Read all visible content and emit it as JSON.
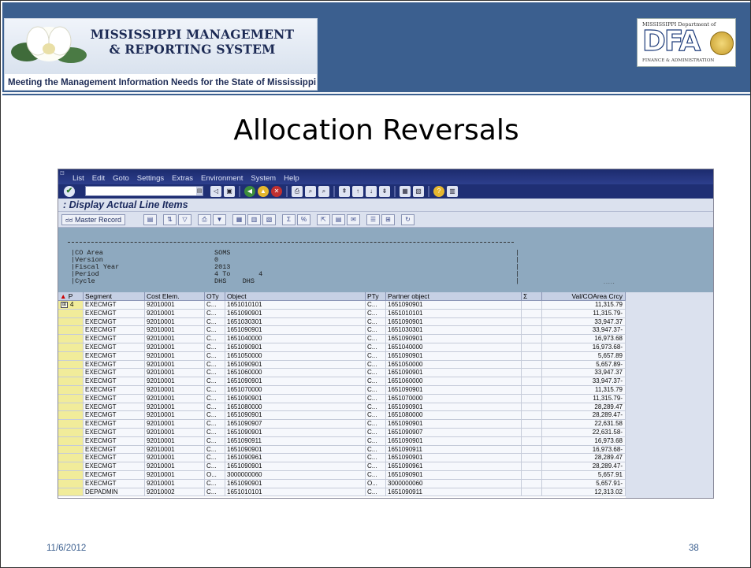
{
  "header": {
    "mmrs_title_line1": "MISSISSIPPI MANAGEMENT",
    "mmrs_title_line2": "& REPORTING SYSTEM",
    "mmrs_subtitle": "Meeting the Management Information Needs for the State of Mississippi",
    "dfa_top": "MISSISSIPPI Department of",
    "dfa_letters": "DFA",
    "dfa_bottom": "FINANCE & ADMINISTRATION",
    "band_color": "#3b5f8f"
  },
  "slide_title": "Allocation Reversals",
  "sap": {
    "menu": [
      "List",
      "Edit",
      "Goto",
      "Settings",
      "Extras",
      "Environment",
      "System",
      "Help"
    ],
    "title": ": Display Actual Line Items",
    "master_record_label": "Master Record",
    "info": {
      "rows": [
        {
          "label": "CO Area",
          "value": "SOMS"
        },
        {
          "label": "Version",
          "value": "0"
        },
        {
          "label": "Fiscal Year",
          "value": "2013"
        },
        {
          "label": "Period",
          "value": "4 To       4"
        },
        {
          "label": "Cycle",
          "value": "DHS    DHS"
        }
      ]
    },
    "columns": [
      "P",
      "Segment",
      "Cost Elem.",
      "OTy",
      "Object",
      "PTy",
      "Partner object",
      "Σ",
      "Val/COArea Crcy"
    ],
    "first_row_marker": "4",
    "rows": [
      {
        "seg": "EXECMGT",
        "ce": "92010001",
        "oty": "C...",
        "obj": "1651010101",
        "pty": "C...",
        "pobj": "1651090901",
        "val": "11,315.79"
      },
      {
        "seg": "EXECMGT",
        "ce": "92010001",
        "oty": "C...",
        "obj": "1651090901",
        "pty": "C...",
        "pobj": "1651010101",
        "val": "11,315.79-"
      },
      {
        "seg": "EXECMGT",
        "ce": "92010001",
        "oty": "C...",
        "obj": "1651030301",
        "pty": "C...",
        "pobj": "1651090901",
        "val": "33,947.37"
      },
      {
        "seg": "EXECMGT",
        "ce": "92010001",
        "oty": "C...",
        "obj": "1651090901",
        "pty": "C...",
        "pobj": "1651030301",
        "val": "33,947.37-"
      },
      {
        "seg": "EXECMGT",
        "ce": "92010001",
        "oty": "C...",
        "obj": "1651040000",
        "pty": "C...",
        "pobj": "1651090901",
        "val": "16,973.68"
      },
      {
        "seg": "EXECMGT",
        "ce": "92010001",
        "oty": "C...",
        "obj": "1651090901",
        "pty": "C...",
        "pobj": "1651040000",
        "val": "16,973.68-"
      },
      {
        "seg": "EXECMGT",
        "ce": "92010001",
        "oty": "C...",
        "obj": "1651050000",
        "pty": "C...",
        "pobj": "1651090901",
        "val": "5,657.89"
      },
      {
        "seg": "EXECMGT",
        "ce": "92010001",
        "oty": "C...",
        "obj": "1651090901",
        "pty": "C...",
        "pobj": "1651050000",
        "val": "5,657.89-"
      },
      {
        "seg": "EXECMGT",
        "ce": "92010001",
        "oty": "C...",
        "obj": "1651060000",
        "pty": "C...",
        "pobj": "1651090901",
        "val": "33,947.37"
      },
      {
        "seg": "EXECMGT",
        "ce": "92010001",
        "oty": "C...",
        "obj": "1651090901",
        "pty": "C...",
        "pobj": "1651060000",
        "val": "33,947.37-"
      },
      {
        "seg": "EXECMGT",
        "ce": "92010001",
        "oty": "C...",
        "obj": "1651070000",
        "pty": "C...",
        "pobj": "1651090901",
        "val": "11,315.79"
      },
      {
        "seg": "EXECMGT",
        "ce": "92010001",
        "oty": "C...",
        "obj": "1651090901",
        "pty": "C...",
        "pobj": "1651070000",
        "val": "11,315.79-"
      },
      {
        "seg": "EXECMGT",
        "ce": "92010001",
        "oty": "C...",
        "obj": "1651080000",
        "pty": "C...",
        "pobj": "1651090901",
        "val": "28,289.47"
      },
      {
        "seg": "EXECMGT",
        "ce": "92010001",
        "oty": "C...",
        "obj": "1651090901",
        "pty": "C...",
        "pobj": "1651080000",
        "val": "28,289.47-"
      },
      {
        "seg": "EXECMGT",
        "ce": "92010001",
        "oty": "C...",
        "obj": "1651090907",
        "pty": "C...",
        "pobj": "1651090901",
        "val": "22,631.58"
      },
      {
        "seg": "EXECMGT",
        "ce": "92010001",
        "oty": "C...",
        "obj": "1651090901",
        "pty": "C...",
        "pobj": "1651090907",
        "val": "22,631.58-"
      },
      {
        "seg": "EXECMGT",
        "ce": "92010001",
        "oty": "C...",
        "obj": "1651090911",
        "pty": "C...",
        "pobj": "1651090901",
        "val": "16,973.68"
      },
      {
        "seg": "EXECMGT",
        "ce": "92010001",
        "oty": "C...",
        "obj": "1651090901",
        "pty": "C...",
        "pobj": "1651090911",
        "val": "16,973.68-"
      },
      {
        "seg": "EXECMGT",
        "ce": "92010001",
        "oty": "C...",
        "obj": "1651090961",
        "pty": "C...",
        "pobj": "1651090901",
        "val": "28,289.47"
      },
      {
        "seg": "EXECMGT",
        "ce": "92010001",
        "oty": "C...",
        "obj": "1651090901",
        "pty": "C...",
        "pobj": "1651090961",
        "val": "28,289.47-"
      },
      {
        "seg": "EXECMGT",
        "ce": "92010001",
        "oty": "O...",
        "obj": "3000000060",
        "pty": "C...",
        "pobj": "1651090901",
        "val": "5,657.91"
      },
      {
        "seg": "EXECMGT",
        "ce": "92010001",
        "oty": "C...",
        "obj": "1651090901",
        "pty": "O...",
        "pobj": "3000000060",
        "val": "5,657.91-"
      },
      {
        "seg": "DEPADMIN",
        "ce": "92010002",
        "oty": "C...",
        "obj": "1651010101",
        "pty": "C...",
        "pobj": "1651090911",
        "val": "12,313.02"
      }
    ]
  },
  "footer": {
    "date": "11/6/2012",
    "page": "38"
  }
}
